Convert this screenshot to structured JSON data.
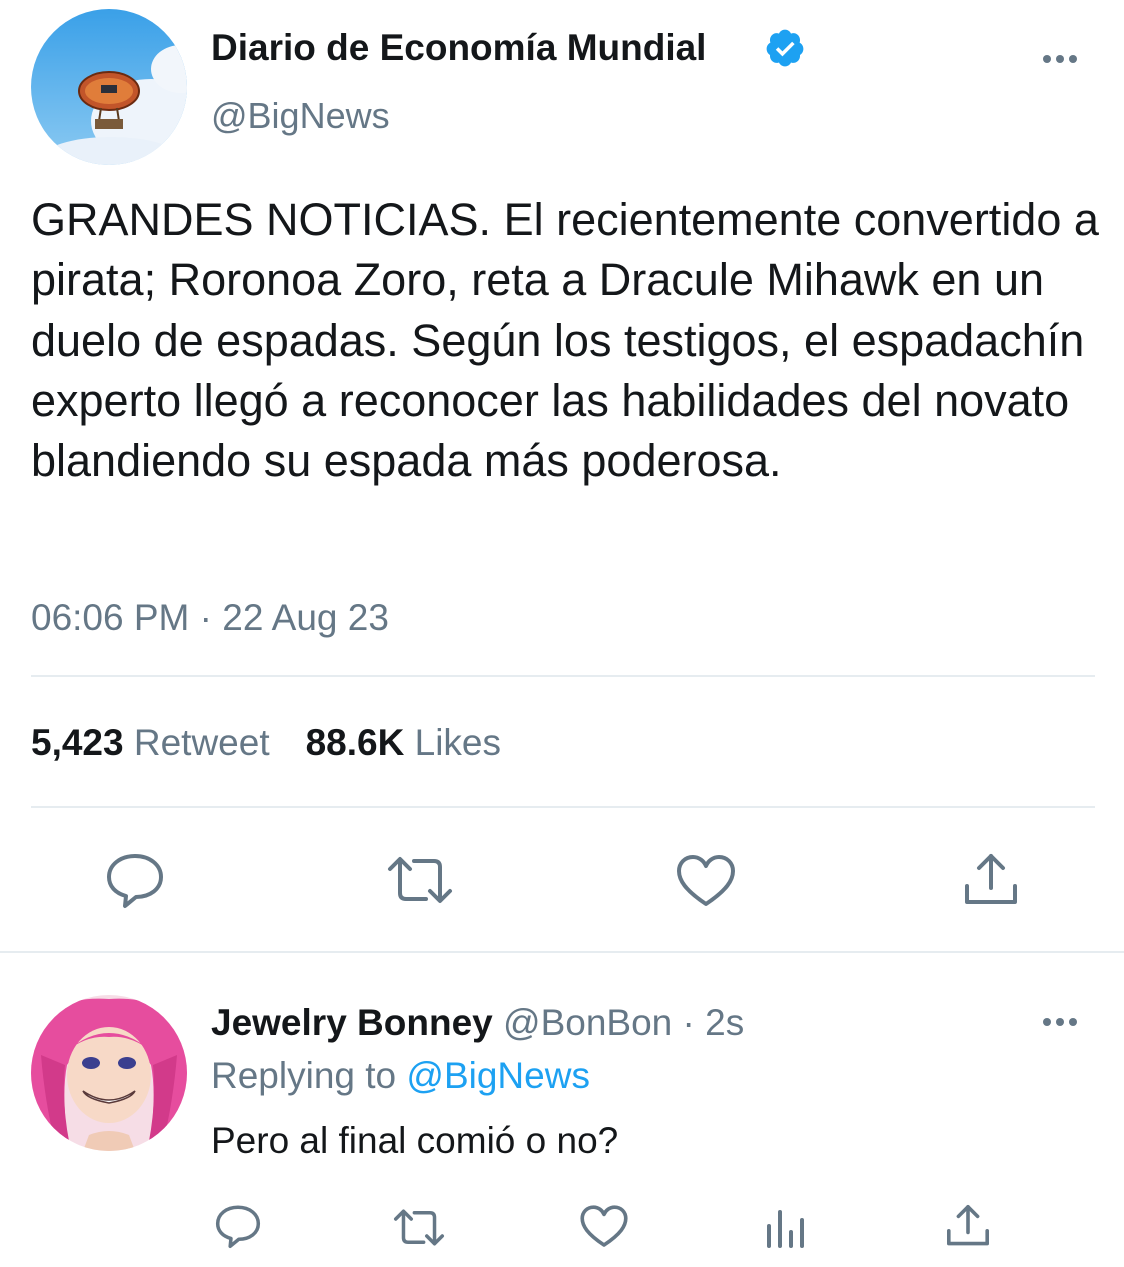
{
  "tweet": {
    "author_name": "Diario de Economía Mundial",
    "author_handle": "@BigNews",
    "verified": true,
    "text": "GRANDES NOTICIAS. El recientemente convertido a pirata; Roronoa Zoro, reta a Dracule Mihawk en un duelo de espadas. Según los testigos, el espadachín experto llegó a reconocer las habilidades del novato blandiendo su espada más poderosa.",
    "timestamp": "06:06 PM · 22 Aug 23",
    "retweets_count": "5,423",
    "retweets_label": "Retweet",
    "likes_count": "88.6K",
    "likes_label": "Likes"
  },
  "reply": {
    "author_name": "Jewelry Bonney",
    "author_handle": "@BonBon",
    "separator": "·",
    "time_ago": "2s",
    "replying_prefix": "Replying to",
    "replying_to": "@BigNews",
    "text": "Pero al final comió o no?"
  },
  "icons": {
    "reply": "comment-icon",
    "retweet": "retweet-icon",
    "like": "heart-icon",
    "share": "share-icon",
    "stats": "bar-chart-icon",
    "more": "more-dots-icon",
    "verified": "verified-badge-icon"
  },
  "colors": {
    "text_primary": "#14171a",
    "text_secondary": "#657786",
    "accent": "#1da1f2",
    "divider": "#e6ecf0"
  }
}
